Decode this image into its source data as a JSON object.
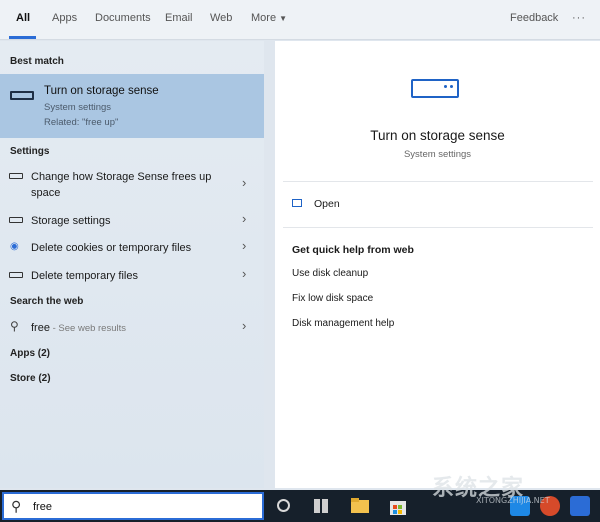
{
  "tabs": {
    "items": [
      "All",
      "Apps",
      "Documents",
      "Email",
      "Web",
      "More"
    ],
    "feedback": "Feedback",
    "overflow": "···"
  },
  "left": {
    "best_match_head": "Best match",
    "best": {
      "title": "Turn on storage sense",
      "subtitle": "System settings",
      "related": "Related: \"free up\""
    },
    "settings_head": "Settings",
    "settings": [
      {
        "label_line1": "Change how Storage Sense frees up",
        "label_line2": "space"
      },
      {
        "label": "Storage settings"
      },
      {
        "label": "Delete cookies or temporary files"
      },
      {
        "label": "Delete temporary files"
      }
    ],
    "web_head": "Search the web",
    "web_query": "free",
    "web_hint": " - See web results",
    "apps_head": "Apps (2)",
    "store_head": "Store (2)"
  },
  "right": {
    "title": "Turn on storage sense",
    "subtitle": "System settings",
    "open_label": "Open",
    "help_head": "Get quick help from web",
    "help_links": [
      "Use disk cleanup",
      "Fix low disk space",
      "Disk management help"
    ]
  },
  "taskbar": {
    "search_value": "free"
  },
  "watermark": {
    "text": "系统之家",
    "sub": "XITONGZHIJIA.NET"
  },
  "colors": {
    "accent": "#2b6cd6",
    "best_highlight": "#aac6e2",
    "taskbar": "#16202b"
  }
}
